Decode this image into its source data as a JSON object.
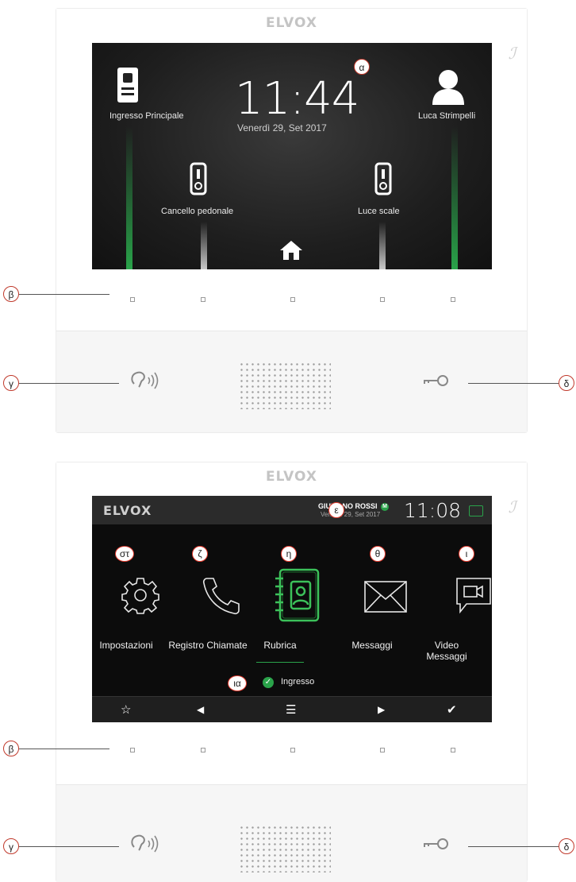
{
  "brand": "ELVOX",
  "top_device": {
    "time": "11:44",
    "date": "Venerdì 29, Set 2017",
    "labels": {
      "entrance": "Ingresso Principale",
      "user": "Luca Strimpelli",
      "gate": "Cancello pedonale",
      "light": "Luce scale"
    },
    "callout_alpha": "α"
  },
  "bottom_device": {
    "header": {
      "user_name": "GIULIANO ROSSI",
      "date": "Venerdì 29, Set 2017",
      "time": "11:08",
      "badge": "M"
    },
    "menu": [
      {
        "label": "Impostazioni",
        "callout": "στ"
      },
      {
        "label": "Registro Chiamate",
        "callout": "ζ"
      },
      {
        "label": "Rubrica",
        "callout": "η"
      },
      {
        "label": "Messaggi",
        "callout": "θ"
      },
      {
        "label": "Video Messaggi",
        "callout": "ι"
      }
    ],
    "status_label": "Ingresso",
    "callout_status": "ια",
    "callout_header": "ε"
  },
  "callouts": {
    "leds": "β",
    "audio_button": "γ",
    "key_button": "δ"
  }
}
